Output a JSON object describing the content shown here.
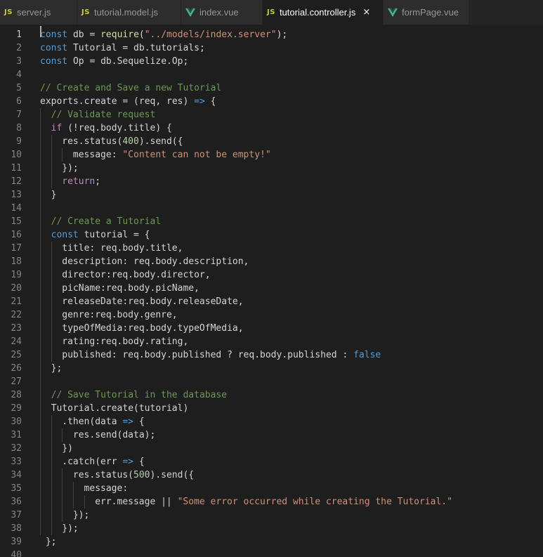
{
  "tabs": [
    {
      "label": "server.js",
      "type": "js",
      "active": false
    },
    {
      "label": "tutorial.model.js",
      "type": "js",
      "active": false
    },
    {
      "label": "index.vue",
      "type": "vue",
      "active": false
    },
    {
      "label": "tutorial.controller.js",
      "type": "js",
      "active": true
    },
    {
      "label": "formPage.vue",
      "type": "vue",
      "active": false
    }
  ],
  "tab_js_badge": "JS",
  "tab_close_glyph": "×",
  "icons": {
    "js": "js-file-icon",
    "vue": "vue-file-icon",
    "close": "close-icon"
  },
  "colors": {
    "editor_bg": "#1e1e1e",
    "tab_bar_bg": "#252526",
    "keyword": "#569cd6",
    "comment": "#6a9955",
    "string": "#ce9178",
    "number": "#b5cea8",
    "control": "#c586c0",
    "vue_icon": "#41b883",
    "js_icon": "#cbcb41"
  },
  "editor": {
    "current_line": 1,
    "lines": [
      {
        "no": "1",
        "indent": 0,
        "tokens": [
          [
            "k",
            "const"
          ],
          [
            "p",
            " db = "
          ],
          [
            "f",
            "require"
          ],
          [
            "p",
            "("
          ],
          [
            "s",
            "\"../models/index.server\""
          ],
          [
            "p",
            ");"
          ]
        ]
      },
      {
        "no": "2",
        "indent": 0,
        "tokens": [
          [
            "k",
            "const"
          ],
          [
            "p",
            " Tutorial = db.tutorials;"
          ]
        ]
      },
      {
        "no": "3",
        "indent": 0,
        "tokens": [
          [
            "k",
            "const"
          ],
          [
            "p",
            " Op = db.Sequelize.Op;"
          ]
        ]
      },
      {
        "no": "4",
        "indent": 0,
        "tokens": []
      },
      {
        "no": "5",
        "indent": 0,
        "tokens": [
          [
            "c",
            "// Create and Save a new Tutorial"
          ]
        ]
      },
      {
        "no": "6",
        "indent": 0,
        "tokens": [
          [
            "p",
            "exports.create = (req, res) "
          ],
          [
            "k",
            "=>"
          ],
          [
            "p",
            " {"
          ]
        ]
      },
      {
        "no": "7",
        "indent": 2,
        "tokens": [
          [
            "c",
            "// Validate request"
          ]
        ]
      },
      {
        "no": "8",
        "indent": 2,
        "tokens": [
          [
            "ctl",
            "if"
          ],
          [
            "p",
            " (!req.body.title) {"
          ]
        ]
      },
      {
        "no": "9",
        "indent": 4,
        "tokens": [
          [
            "p",
            "res.status("
          ],
          [
            "n",
            "400"
          ],
          [
            "p",
            ").send({"
          ]
        ]
      },
      {
        "no": "10",
        "indent": 6,
        "tokens": [
          [
            "p",
            "message: "
          ],
          [
            "s",
            "\"Content can not be empty!\""
          ]
        ]
      },
      {
        "no": "11",
        "indent": 4,
        "tokens": [
          [
            "p",
            "});"
          ]
        ]
      },
      {
        "no": "12",
        "indent": 4,
        "tokens": [
          [
            "ctl",
            "return"
          ],
          [
            "p",
            ";"
          ]
        ]
      },
      {
        "no": "13",
        "indent": 2,
        "tokens": [
          [
            "p",
            "}"
          ]
        ]
      },
      {
        "no": "14",
        "indent": 0,
        "tokens": []
      },
      {
        "no": "15",
        "indent": 2,
        "tokens": [
          [
            "c",
            "// Create a Tutorial"
          ]
        ]
      },
      {
        "no": "16",
        "indent": 2,
        "tokens": [
          [
            "k",
            "const"
          ],
          [
            "p",
            " tutorial = {"
          ]
        ]
      },
      {
        "no": "17",
        "indent": 4,
        "tokens": [
          [
            "p",
            "title: req.body.title,"
          ]
        ]
      },
      {
        "no": "18",
        "indent": 4,
        "tokens": [
          [
            "p",
            "description: req.body.description,"
          ]
        ]
      },
      {
        "no": "19",
        "indent": 4,
        "tokens": [
          [
            "p",
            "director:req.body.director,"
          ]
        ]
      },
      {
        "no": "20",
        "indent": 4,
        "tokens": [
          [
            "p",
            "picName:req.body.picName,"
          ]
        ]
      },
      {
        "no": "21",
        "indent": 4,
        "tokens": [
          [
            "p",
            "releaseDate:req.body.releaseDate,"
          ]
        ]
      },
      {
        "no": "22",
        "indent": 4,
        "tokens": [
          [
            "p",
            "genre:req.body.genre,"
          ]
        ]
      },
      {
        "no": "23",
        "indent": 4,
        "tokens": [
          [
            "p",
            "typeOfMedia:req.body.typeOfMedia,"
          ]
        ]
      },
      {
        "no": "24",
        "indent": 4,
        "tokens": [
          [
            "p",
            "rating:req.body.rating,"
          ]
        ]
      },
      {
        "no": "25",
        "indent": 4,
        "tokens": [
          [
            "p",
            "published: req.body.published ? req.body.published : "
          ],
          [
            "k",
            "false"
          ]
        ]
      },
      {
        "no": "26",
        "indent": 2,
        "tokens": [
          [
            "p",
            "};"
          ]
        ]
      },
      {
        "no": "27",
        "indent": 0,
        "tokens": []
      },
      {
        "no": "28",
        "indent": 2,
        "tokens": [
          [
            "c",
            "// Save Tutorial in the database"
          ]
        ]
      },
      {
        "no": "29",
        "indent": 2,
        "tokens": [
          [
            "p",
            "Tutorial.create(tutorial)"
          ]
        ]
      },
      {
        "no": "30",
        "indent": 4,
        "tokens": [
          [
            "p",
            ".then(data "
          ],
          [
            "k",
            "=>"
          ],
          [
            "p",
            " {"
          ]
        ]
      },
      {
        "no": "31",
        "indent": 6,
        "tokens": [
          [
            "p",
            "res.send(data);"
          ]
        ]
      },
      {
        "no": "32",
        "indent": 4,
        "tokens": [
          [
            "p",
            "})"
          ]
        ]
      },
      {
        "no": "33",
        "indent": 4,
        "tokens": [
          [
            "p",
            ".catch(err "
          ],
          [
            "k",
            "=>"
          ],
          [
            "p",
            " {"
          ]
        ]
      },
      {
        "no": "34",
        "indent": 6,
        "tokens": [
          [
            "p",
            "res.status("
          ],
          [
            "n",
            "500"
          ],
          [
            "p",
            ").send({"
          ]
        ]
      },
      {
        "no": "35",
        "indent": 8,
        "tokens": [
          [
            "p",
            "message:"
          ]
        ]
      },
      {
        "no": "36",
        "indent": 10,
        "tokens": [
          [
            "p",
            "err.message || "
          ],
          [
            "s",
            "\"Some error occurred while creating the Tutorial.\""
          ]
        ]
      },
      {
        "no": "37",
        "indent": 6,
        "tokens": [
          [
            "p",
            "});"
          ]
        ]
      },
      {
        "no": "38",
        "indent": 4,
        "tokens": [
          [
            "p",
            "});"
          ]
        ]
      },
      {
        "no": "39",
        "indent": 1,
        "tokens": [
          [
            "p",
            "};"
          ]
        ]
      },
      {
        "no": "40",
        "indent": 0,
        "tokens": []
      }
    ]
  }
}
